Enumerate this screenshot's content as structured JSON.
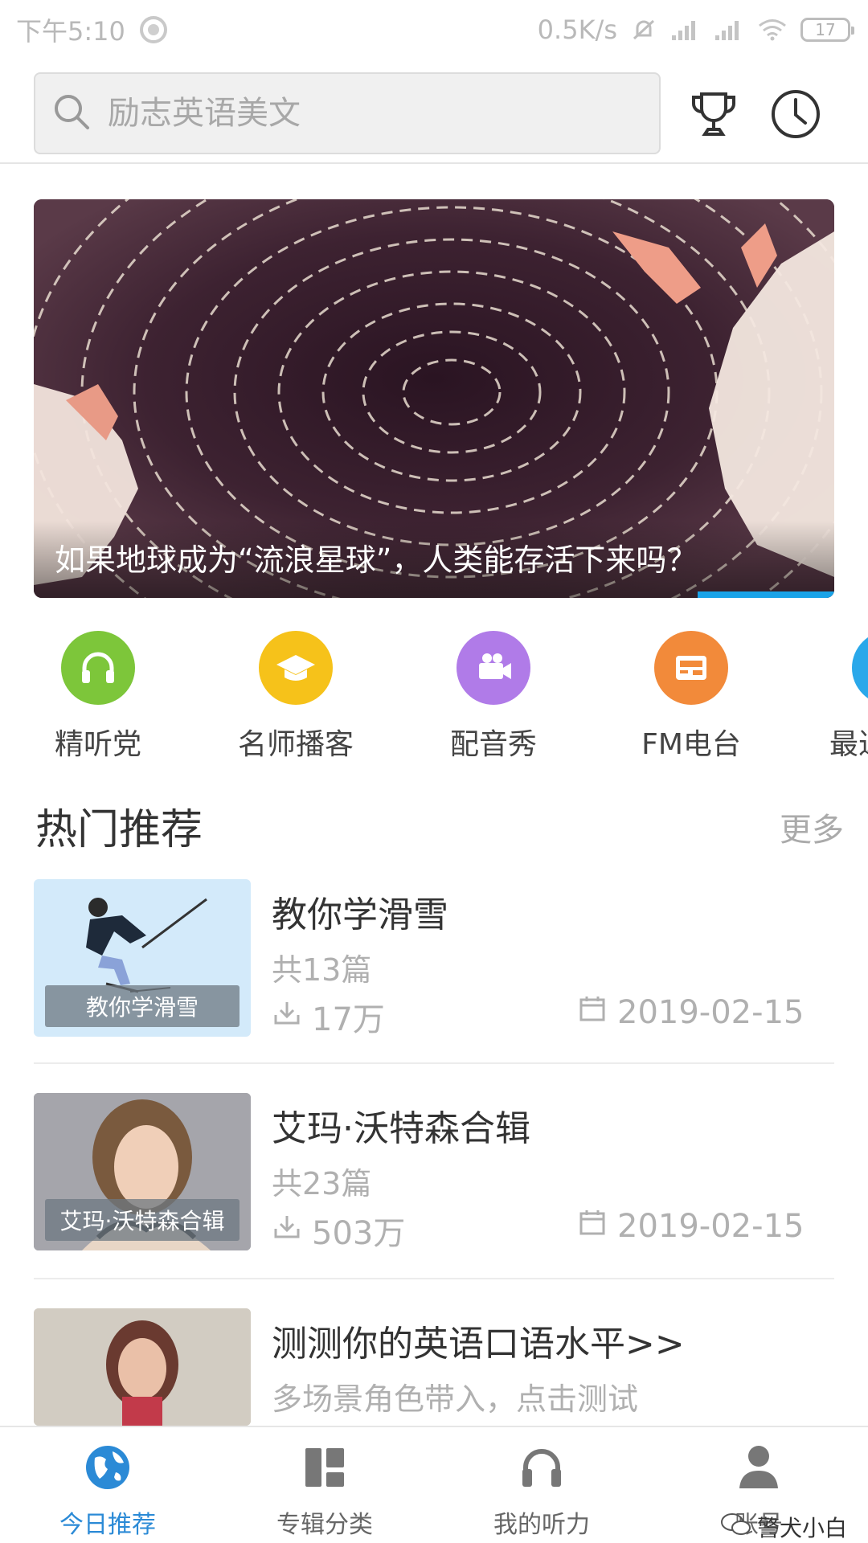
{
  "status_bar": {
    "time": "下午5:10",
    "net_speed": "0.5K/s",
    "battery": "17"
  },
  "search": {
    "placeholder": "励志英语美文"
  },
  "header_icons": [
    "trophy-icon",
    "history-clock-icon"
  ],
  "banner": {
    "caption": "如果地球成为“流浪星球”，人类能存活下来吗？"
  },
  "categories": [
    {
      "label": "精听党",
      "icon": "headphones-icon",
      "color": "#7dc63a"
    },
    {
      "label": "名师播客",
      "icon": "graduation-cap-icon",
      "color": "#f6c21a"
    },
    {
      "label": "配音秀",
      "icon": "video-camera-icon",
      "color": "#b07be8"
    },
    {
      "label": "FM电台",
      "icon": "radio-icon",
      "color": "#f28a3a"
    },
    {
      "label": "最近",
      "icon": "recent-icon",
      "color": "#2aa8ea"
    }
  ],
  "hot": {
    "title": "热门推荐",
    "more": "更多"
  },
  "items": [
    {
      "title": "教你学滑雪",
      "thumb_label": "教你学滑雪",
      "count": "共13篇",
      "downloads": "17万",
      "date": "2019-02-15"
    },
    {
      "title": "艾玛·沃特森合辑",
      "thumb_label": "艾玛·沃特森合辑",
      "count": "共23篇",
      "downloads": "503万",
      "date": "2019-02-15"
    },
    {
      "title": "测测你的英语口语水平>>",
      "subtitle": "多场景角色带入，点击测试"
    }
  ],
  "nav": [
    {
      "label": "今日推荐",
      "icon": "globe-icon",
      "active": true
    },
    {
      "label": "专辑分类",
      "icon": "grid-icon"
    },
    {
      "label": "我的听力",
      "icon": "headphones-icon"
    },
    {
      "label": "账号",
      "icon": "user-icon"
    }
  ],
  "watermark": "警犬小白",
  "colors": {
    "accent": "#2b8ad6",
    "indicator": "#1aa3e8"
  }
}
